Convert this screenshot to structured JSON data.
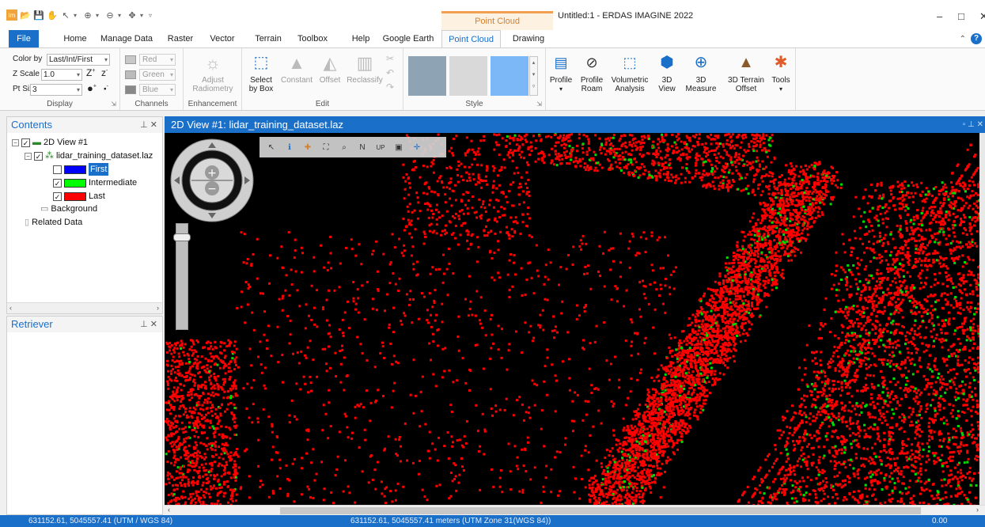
{
  "app": {
    "title": "Untitled:1 - ERDAS IMAGINE 2022",
    "context_tab_header": "Point Cloud"
  },
  "tabs": [
    "File",
    "Home",
    "Manage Data",
    "Raster",
    "Vector",
    "Terrain",
    "Toolbox",
    "Help",
    "Google Earth",
    "Point Cloud",
    "Drawing"
  ],
  "active_tab": "Point Cloud",
  "ribbon": {
    "display": {
      "label": "Display",
      "color_by_label": "Color by",
      "color_by_value": "Last/Int/First",
      "zscale_label": "Z Scale",
      "zscale_value": "1.0",
      "ptsize_label": "Pt Size",
      "ptsize_value": "3"
    },
    "channels": {
      "label": "Channels",
      "red": "Red",
      "green": "Green",
      "blue": "Blue"
    },
    "enhancement": {
      "label": "Enhancement",
      "adjust_radiometry": "Adjust Radiometry"
    },
    "edit": {
      "label": "Edit",
      "select_by_box": "Select by Box",
      "constant": "Constant",
      "offset": "Offset",
      "reclassify": "Reclassify"
    },
    "style": {
      "label": "Style",
      "swatches": [
        "#8ea4b5",
        "#d9d9d9",
        "#7cb8f7"
      ]
    },
    "tools": {
      "profile": "Profile",
      "profile_roam": "Profile Roam",
      "volumetric_analysis": "Volumetric Analysis",
      "view_3d": "3D View",
      "measure_3d": "3D Measure",
      "terrain_offset": "3D Terrain Offset",
      "tools": "Tools"
    }
  },
  "contents": {
    "title": "Contents",
    "view_name": "2D View #1",
    "dataset": "lidar_training_dataset.laz",
    "layers": [
      {
        "name": "First",
        "color": "#0000ff",
        "checked": false,
        "selected": true
      },
      {
        "name": "Intermediate",
        "color": "#00ff00",
        "checked": true,
        "selected": false
      },
      {
        "name": "Last",
        "color": "#ff0000",
        "checked": true,
        "selected": false
      }
    ],
    "background": "Background",
    "related_data": "Related Data"
  },
  "retriever": {
    "title": "Retriever"
  },
  "view": {
    "title": "2D View #1: lidar_training_dataset.laz"
  },
  "status": {
    "left": "631152.61, 5045557.41 (UTM / WGS 84)",
    "center": "631152.61, 5045557.41 meters (UTM Zone 31(WGS 84))",
    "right": "0.00"
  },
  "colors": {
    "accent": "#1a6fc9",
    "context_orange": "#d4802e",
    "points_last": "#ff0000",
    "points_intermediate": "#00dd00"
  }
}
